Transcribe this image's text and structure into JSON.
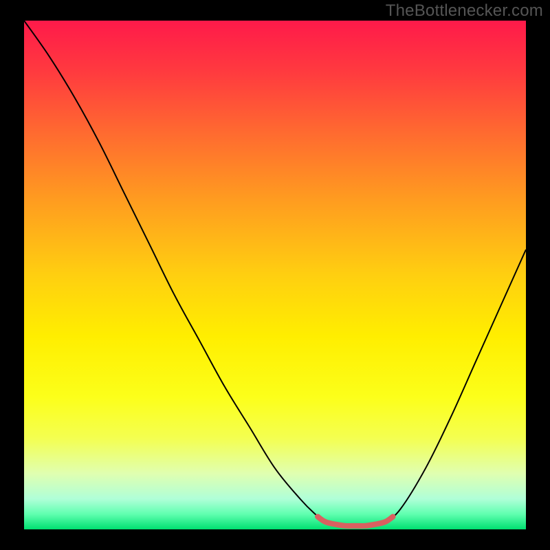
{
  "watermark": "TheBottlenecker.com",
  "chart_data": {
    "type": "line",
    "title": "",
    "xlabel": "",
    "ylabel": "",
    "xlim": [
      0,
      100
    ],
    "ylim": [
      0,
      100
    ],
    "background_gradient": {
      "stops": [
        {
          "offset": 0.0,
          "color": "#ff1a4a"
        },
        {
          "offset": 0.1,
          "color": "#ff3a3f"
        },
        {
          "offset": 0.22,
          "color": "#ff6a30"
        },
        {
          "offset": 0.35,
          "color": "#ff9b20"
        },
        {
          "offset": 0.5,
          "color": "#ffcf10"
        },
        {
          "offset": 0.62,
          "color": "#ffee00"
        },
        {
          "offset": 0.74,
          "color": "#fcff1a"
        },
        {
          "offset": 0.82,
          "color": "#f4ff50"
        },
        {
          "offset": 0.89,
          "color": "#e0ffb0"
        },
        {
          "offset": 0.94,
          "color": "#b0ffd8"
        },
        {
          "offset": 0.97,
          "color": "#60ffb0"
        },
        {
          "offset": 1.0,
          "color": "#00e070"
        }
      ]
    },
    "series": [
      {
        "name": "bottleneck-curve",
        "color": "#000000",
        "width": 2,
        "points": [
          {
            "x": 0.0,
            "y": 100.0
          },
          {
            "x": 5.0,
            "y": 93.0
          },
          {
            "x": 10.0,
            "y": 85.0
          },
          {
            "x": 15.0,
            "y": 76.0
          },
          {
            "x": 20.0,
            "y": 66.0
          },
          {
            "x": 25.0,
            "y": 56.0
          },
          {
            "x": 30.0,
            "y": 46.0
          },
          {
            "x": 35.0,
            "y": 37.0
          },
          {
            "x": 40.0,
            "y": 28.0
          },
          {
            "x": 45.0,
            "y": 20.0
          },
          {
            "x": 50.0,
            "y": 12.0
          },
          {
            "x": 55.0,
            "y": 6.0
          },
          {
            "x": 58.0,
            "y": 3.0
          },
          {
            "x": 60.0,
            "y": 1.5
          },
          {
            "x": 62.0,
            "y": 0.8
          },
          {
            "x": 64.0,
            "y": 0.5
          },
          {
            "x": 66.0,
            "y": 0.5
          },
          {
            "x": 68.0,
            "y": 0.5
          },
          {
            "x": 70.0,
            "y": 0.8
          },
          {
            "x": 72.0,
            "y": 1.5
          },
          {
            "x": 75.0,
            "y": 4.0
          },
          {
            "x": 80.0,
            "y": 12.0
          },
          {
            "x": 85.0,
            "y": 22.0
          },
          {
            "x": 90.0,
            "y": 33.0
          },
          {
            "x": 95.0,
            "y": 44.0
          },
          {
            "x": 100.0,
            "y": 55.0
          }
        ]
      },
      {
        "name": "sweet-spot-marker",
        "color": "#d96060",
        "width": 8,
        "points": [
          {
            "x": 58.5,
            "y": 2.5
          },
          {
            "x": 60.0,
            "y": 1.5
          },
          {
            "x": 62.0,
            "y": 1.0
          },
          {
            "x": 64.0,
            "y": 0.7
          },
          {
            "x": 66.0,
            "y": 0.7
          },
          {
            "x": 68.0,
            "y": 0.7
          },
          {
            "x": 70.0,
            "y": 1.0
          },
          {
            "x": 72.0,
            "y": 1.5
          },
          {
            "x": 73.5,
            "y": 2.5
          }
        ]
      }
    ]
  }
}
